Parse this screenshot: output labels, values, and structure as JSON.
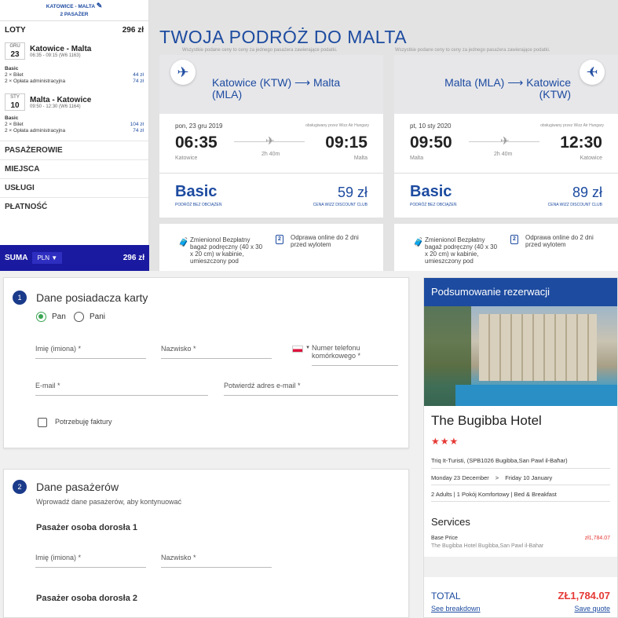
{
  "sidebar": {
    "header_line1": "KATOWICE - MALTA",
    "header_line2": "2 PASAŻER",
    "flights_label": "LOTY",
    "flights_total": "296 zł",
    "flight1": {
      "month": "GRU",
      "day": "23",
      "title": "Katowice - Malta",
      "detail": "06:35 - 09:15 (W6 1163)",
      "fare_name": "Basic",
      "line1": "2 × Bilet",
      "line1_price": "44 zł",
      "line2": "2 × Opłata administracyjna",
      "line2_price": "74 zł"
    },
    "flight2": {
      "month": "STY",
      "day": "10",
      "title": "Malta - Katowice",
      "detail": "09:50 - 12:30 (W6 1164)",
      "fare_name": "Basic",
      "line1": "2 × Bilet",
      "line1_price": "104 zł",
      "line2": "2 × Opłata administracyjna",
      "line2_price": "74 zł"
    },
    "sections": [
      "PASAŻEROWIE",
      "MIEJSCA",
      "USŁUGI",
      "PŁATNOŚĆ"
    ],
    "sum_label": "SUMA",
    "currency": "PLN",
    "sum_total": "296 zł"
  },
  "page_title": "TWOJA PODRÓŻ DO MALTA",
  "price_note": "Wszystkie podane ceny to ceny za jednego pasażera zawierające podatki.",
  "outbound": {
    "route": "Katowice (KTW) ⟶ Malta (MLA)",
    "date": "pon, 23 gru 2019",
    "operator": "obsługiwany przez Wizz Air Hungary",
    "dep_time": "06:35",
    "arr_time": "09:15",
    "dep_city": "Katowice",
    "arr_city": "Malta",
    "duration": "2h 40m",
    "fare": "Basic",
    "fare_sub": "PODRÓŻ BEZ OBCIĄŻEŃ",
    "price": "59 zł",
    "price_sub": "CENA WIZZ DISCOUNT CLUB",
    "info1": "Zmienionol Bezpłatny bagaż podręczny (40 x 30 x 20 cm) w kabinie, umieszczony pod",
    "info2": "Odprawa online do 2 dni przed wylotem"
  },
  "inbound": {
    "route": "Malta (MLA) ⟶ Katowice (KTW)",
    "date": "pt, 10 sty 2020",
    "operator": "obsługiwany przez Wizz Air Hungary",
    "dep_time": "09:50",
    "arr_time": "12:30",
    "dep_city": "Malta",
    "arr_city": "Katowice",
    "duration": "2h 40m",
    "fare": "Basic",
    "fare_sub": "PODRÓŻ BEZ OBCIĄŻEŃ",
    "price": "89 zł",
    "price_sub": "CENA WIZZ DISCOUNT CLUB",
    "info1": "Zmienionol Bezpłatny bagaż podręczny (40 x 30 x 20 cm) w kabinie, umieszczony pod",
    "info2": "Odprawa online do 2 dni przed wylotem"
  },
  "cardholder": {
    "step": "1",
    "title": "Dane posiadacza karty",
    "opt_pan": "Pan",
    "opt_pani": "Pani",
    "first_name": "Imię (imiona) *",
    "last_name": "Nazwisko *",
    "phone": "Numer telefonu komórkowego *",
    "email": "E-mail *",
    "email_confirm": "Potwierdź adres e-mail *",
    "invoice": "Potrzebuję faktury"
  },
  "passengers": {
    "step": "2",
    "title": "Dane pasażerów",
    "subtitle": "Wprowadź dane pasażerów, aby kontynuować",
    "adult1": "Pasażer osoba dorosła 1",
    "first_name": "Imię (imiona) *",
    "last_name": "Nazwisko *",
    "adult2": "Pasażer osoba dorosła 2"
  },
  "summary": {
    "header": "Podsumowanie rezerwacji",
    "hotel": "The Bugibba Hotel",
    "stars": "★★★",
    "address": "Triq It-Turisti, (SPB1026 Bugibba,San Pawl il-Baħar)",
    "dates_from": "Monday 23 December",
    "dates_sep": ">",
    "dates_to": "Friday 10 January",
    "room": "2 Adults | 1 Pokój Komfortowy | Bed & Breakfast",
    "services_title": "Services",
    "base_label": "Base Price",
    "base_price": "zł1,784.07",
    "base_desc": "The Bugibba Hotel Bugibba,San Pawl il-Bahar",
    "total_label": "TOTAL",
    "total_value": "ZŁ1,784.07",
    "breakdown": "See breakdown",
    "save_quote": "Save quote"
  },
  "colors": {
    "brand": "#1d4ba0",
    "sum_bar": "#1a1aa0",
    "price_red": "#e53935",
    "radio_green": "#3aa552"
  }
}
